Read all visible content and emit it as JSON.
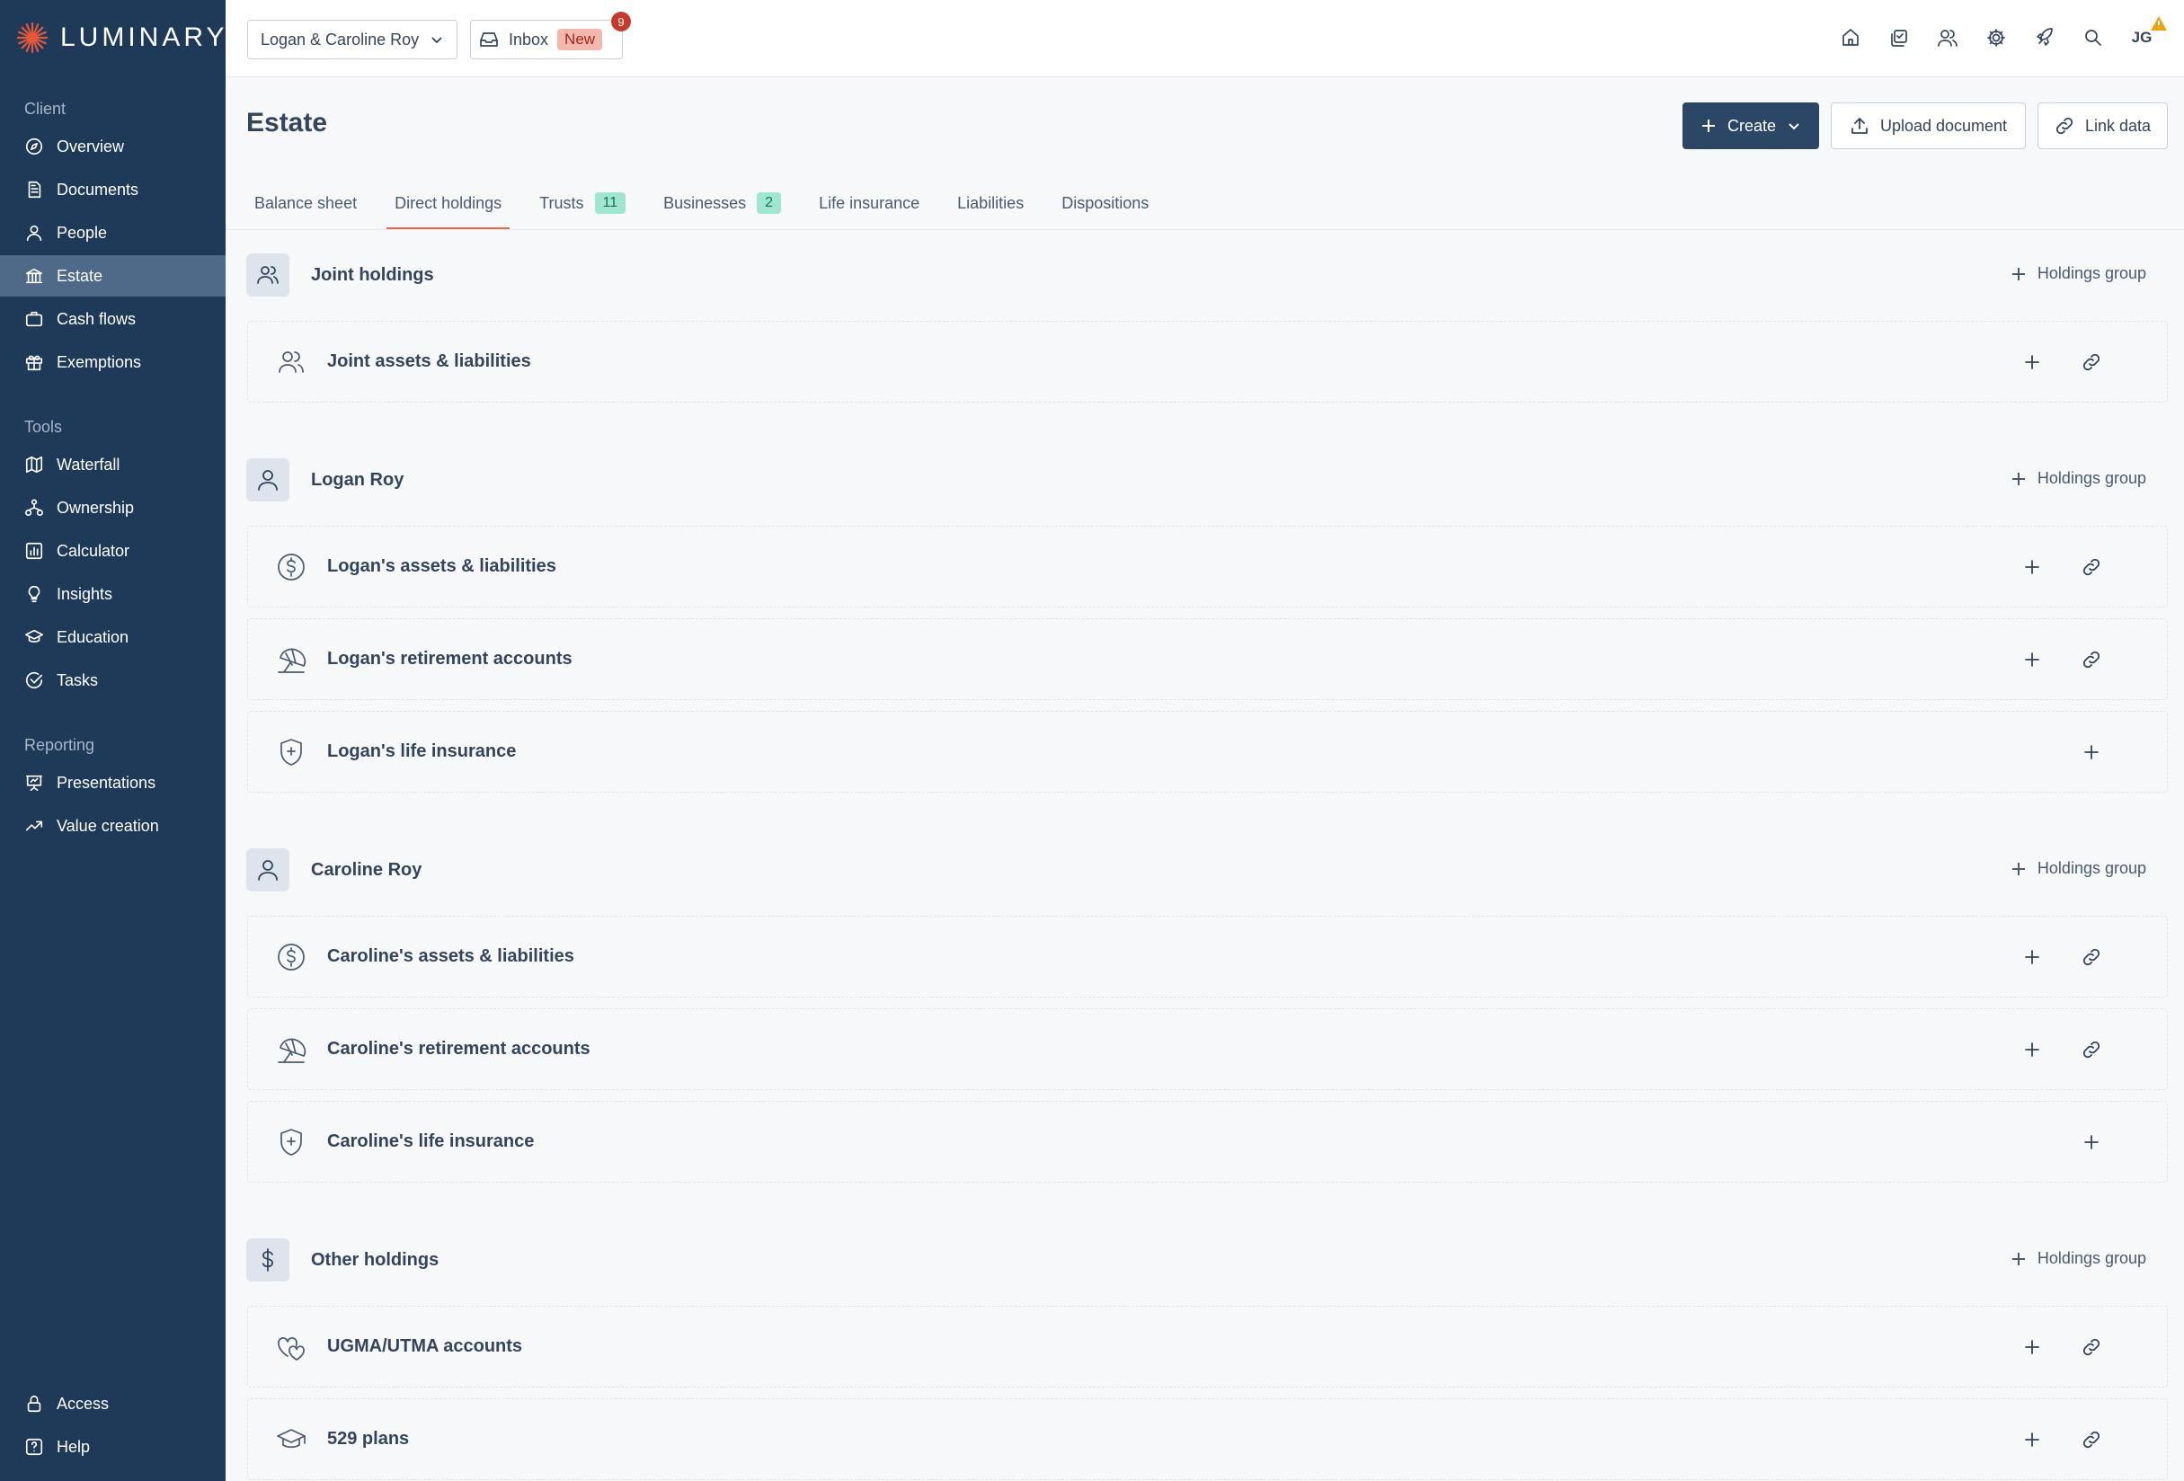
{
  "app": {
    "logo_text": "LUMINARY",
    "accent": "#e26b4a",
    "sidebar_bg": "#1f3a59"
  },
  "sidebar": {
    "sections": [
      {
        "label": "Client",
        "items": [
          {
            "label": "Overview",
            "icon": "compass-icon"
          },
          {
            "label": "Documents",
            "icon": "document-icon"
          },
          {
            "label": "People",
            "icon": "person-icon"
          },
          {
            "label": "Estate",
            "icon": "bank-icon",
            "active": true
          },
          {
            "label": "Cash flows",
            "icon": "briefcase-icon"
          },
          {
            "label": "Exemptions",
            "icon": "gift-icon"
          }
        ]
      },
      {
        "label": "Tools",
        "items": [
          {
            "label": "Waterfall",
            "icon": "map-icon"
          },
          {
            "label": "Ownership",
            "icon": "hierarchy-icon"
          },
          {
            "label": "Calculator",
            "icon": "bar-chart-icon"
          },
          {
            "label": "Insights",
            "icon": "lightbulb-icon"
          },
          {
            "label": "Education",
            "icon": "graduation-cap-icon"
          },
          {
            "label": "Tasks",
            "icon": "check-circle-icon"
          }
        ]
      },
      {
        "label": "Reporting",
        "items": [
          {
            "label": "Presentations",
            "icon": "presentation-icon"
          },
          {
            "label": "Value creation",
            "icon": "trend-up-icon"
          }
        ]
      }
    ],
    "footer": [
      {
        "label": "Access",
        "icon": "lock-icon"
      },
      {
        "label": "Help",
        "icon": "help-icon"
      }
    ]
  },
  "topbar": {
    "client_select": "Logan & Caroline Roy",
    "inbox_label": "Inbox",
    "inbox_new": "New",
    "inbox_count": "9",
    "avatar_initials": "JG"
  },
  "header": {
    "title": "Estate",
    "create_label": "Create",
    "upload_label": "Upload document",
    "link_label": "Link data"
  },
  "tabs": [
    {
      "label": "Balance sheet"
    },
    {
      "label": "Direct holdings",
      "active": true
    },
    {
      "label": "Trusts",
      "badge": "11"
    },
    {
      "label": "Businesses",
      "badge": "2"
    },
    {
      "label": "Life insurance"
    },
    {
      "label": "Liabilities"
    },
    {
      "label": "Dispositions"
    }
  ],
  "holdings_group_label": "Holdings group",
  "groups": [
    {
      "name": "Joint holdings",
      "icon": "people-icon",
      "cards": [
        {
          "name": "Joint assets & liabilities",
          "icon": "people-icon",
          "link": true
        }
      ]
    },
    {
      "name": "Logan Roy",
      "icon": "person-icon",
      "cards": [
        {
          "name": "Logan's assets & liabilities",
          "icon": "dollar-circle-icon",
          "link": true
        },
        {
          "name": "Logan's retirement accounts",
          "icon": "beach-umbrella-icon",
          "link": true
        },
        {
          "name": "Logan's life insurance",
          "icon": "shield-plus-icon",
          "link": false
        }
      ]
    },
    {
      "name": "Caroline Roy",
      "icon": "person-icon",
      "cards": [
        {
          "name": "Caroline's assets & liabilities",
          "icon": "dollar-circle-icon",
          "link": true
        },
        {
          "name": "Caroline's retirement accounts",
          "icon": "beach-umbrella-icon",
          "link": true
        },
        {
          "name": "Caroline's life insurance",
          "icon": "shield-plus-icon",
          "link": false
        }
      ]
    },
    {
      "name": "Other holdings",
      "icon": "dollar-icon",
      "cards": [
        {
          "name": "UGMA/UTMA accounts",
          "icon": "hearts-icon",
          "link": true
        },
        {
          "name": "529 plans",
          "icon": "graduation-cap-icon",
          "link": true
        }
      ]
    }
  ]
}
